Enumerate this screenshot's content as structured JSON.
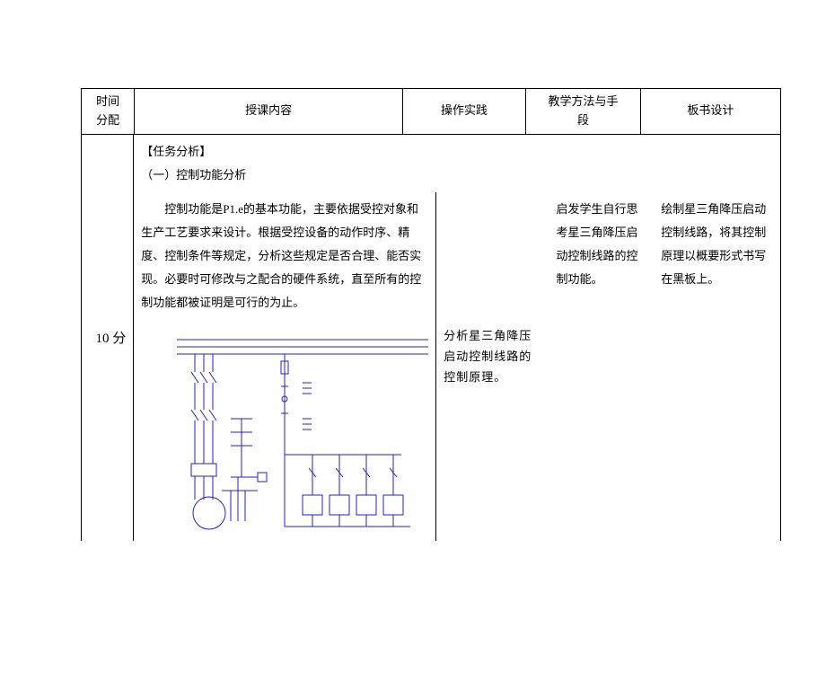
{
  "header": {
    "time": "时间\n分配",
    "lecture": "授课内容",
    "practice": "操作实践",
    "method": "教学方法与手\n段",
    "board": "板书设计"
  },
  "body": {
    "row1": {
      "time": "",
      "lecture_title": "【任务分析】",
      "lecture_sub": "（一）控制功能分析",
      "lecture_para": "控制功能是P1.e的基本功能，主要依据受控对象和生产工艺要求来设计。根据受控设备的动作时序、精度、控制条件等规定，分析这些规定是否合理、能否实现。必要时可修改与之配合的硬件系统，直至所有的控制功能都被证明是可行的为止。",
      "method": "启发学生自行思考星三角降压启动控制线路的控制功能。",
      "board": "绘制星三角降压启动控制线路，将其控制原理以概要形式书写在黑板上。"
    },
    "row2": {
      "time": "10 分",
      "practice": "分析星三角降压启动控制线路的控制原理。"
    }
  }
}
